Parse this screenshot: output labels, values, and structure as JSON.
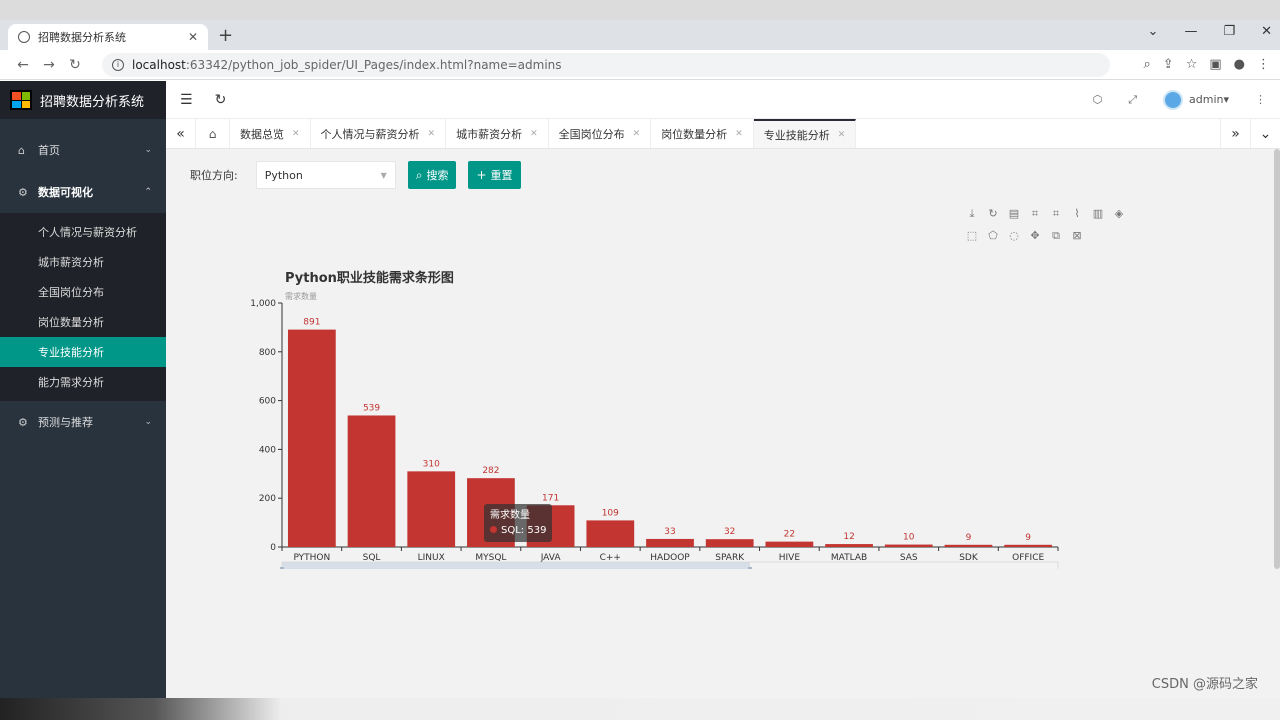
{
  "browser": {
    "tab_title": "招聘数据分析系统",
    "url_host": "localhost",
    "url_path": ":63342/python_job_spider/UI_Pages/index.html?name=admins"
  },
  "app": {
    "title": "招聘数据分析系统",
    "user": "admin"
  },
  "sidebar": {
    "home": "首页",
    "group_viz": "数据可视化",
    "sub_items": [
      "个人情况与薪资分析",
      "城市薪资分析",
      "全国岗位分布",
      "岗位数量分析",
      "专业技能分析",
      "能力需求分析"
    ],
    "active_index": 4,
    "group_predict": "预测与推荐"
  },
  "page_tabs": [
    "数据总览",
    "个人情况与薪资分析",
    "城市薪资分析",
    "全国岗位分布",
    "岗位数量分析",
    "专业技能分析"
  ],
  "filter": {
    "label": "职位方向:",
    "selected": "Python",
    "search_label": "搜索",
    "reset_label": "重置"
  },
  "chart_data": {
    "type": "bar",
    "title": "Python职业技能需求条形图",
    "ylabel": "需求数量",
    "series_name": "需求数量",
    "categories": [
      "PYTHON",
      "SQL",
      "LINUX",
      "MYSQL",
      "JAVA",
      "C++",
      "HADOOP",
      "SPARK",
      "HIVE",
      "MATLAB",
      "SAS",
      "SDK",
      "OFFICE"
    ],
    "values": [
      891,
      539,
      310,
      282,
      171,
      109,
      33,
      32,
      22,
      12,
      10,
      9,
      9
    ],
    "ylim": [
      0,
      1000
    ],
    "yticks": [
      "0",
      "200",
      "400",
      "600",
      "800",
      "1,000"
    ],
    "bar_color": "#c23531",
    "grid": false,
    "datazoom": true
  },
  "tooltip": {
    "title": "需求数量",
    "text": "SQL: 539"
  },
  "watermark": "CSDN @源码之家"
}
